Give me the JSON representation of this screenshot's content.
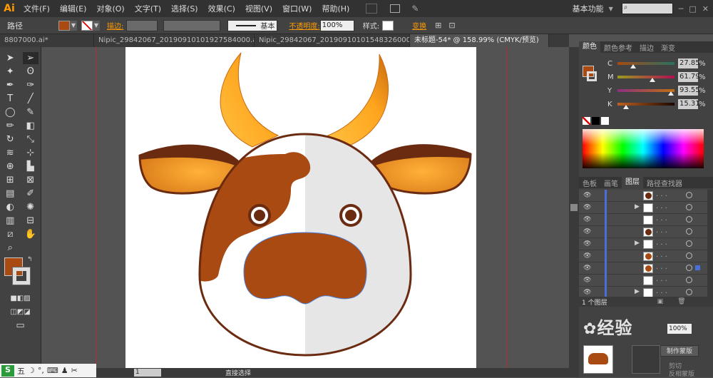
{
  "app": {
    "logo": "Ai",
    "workspace": "基本功能"
  },
  "menu": [
    "文件(F)",
    "编辑(E)",
    "对象(O)",
    "文字(T)",
    "选择(S)",
    "效果(C)",
    "视图(V)",
    "窗口(W)",
    "帮助(H)"
  ],
  "control": {
    "object_type": "路径",
    "stroke_label": "描边:",
    "stroke_profile": "基本",
    "opacity_label": "不透明度:",
    "opacity_value": "100%",
    "style_label": "样式:",
    "transform_label": "变换"
  },
  "tabs": [
    "8807000.ai*",
    "Nipic_29842067_20190910101927584000.ai*",
    "Nipic_29842067_20190910101548326000.ai*",
    "未标题-54* @ 158.99% (CMYK/预览)"
  ],
  "colors": {
    "fill": "#a84a12",
    "dark_brown": "#6b2b10",
    "horn_light": "#ffb12a",
    "face_gray": "#e6e6e6",
    "accent_orange": "#ff9a00"
  },
  "color_panel": {
    "tabs": [
      "颜色",
      "颜色参考",
      "描边",
      "渐变"
    ],
    "channels": [
      {
        "label": "C",
        "value": "27.85",
        "unit": "%",
        "level": 0.2785
      },
      {
        "label": "M",
        "value": "61.79",
        "unit": "%",
        "level": 0.6179
      },
      {
        "label": "Y",
        "value": "93.55",
        "unit": "%",
        "level": 0.9355
      },
      {
        "label": "K",
        "value": "15.31",
        "unit": "%",
        "level": 0.1531
      }
    ]
  },
  "layers_panel": {
    "tabs": [
      "色板",
      "画笔",
      "图层",
      "路径查找器"
    ],
    "footer": "1 个图层",
    "rows": [
      {
        "arrow": "",
        "thumb": "#6b2b10",
        "selected": false
      },
      {
        "arrow": "▶",
        "thumb": "#ffffff",
        "selected": false
      },
      {
        "arrow": "",
        "thumb": "#ffffff",
        "selected": false
      },
      {
        "arrow": "",
        "thumb": "#6b2b10",
        "selected": false
      },
      {
        "arrow": "▶",
        "thumb": "#ffffff",
        "selected": false
      },
      {
        "arrow": "",
        "thumb": "#a84a12",
        "selected": false
      },
      {
        "arrow": "",
        "thumb": "#a84a12",
        "selected": true
      },
      {
        "arrow": "",
        "thumb": "#ffffff",
        "selected": false
      },
      {
        "arrow": "▶",
        "thumb": "#ffffff",
        "selected": false
      }
    ]
  },
  "bottom_panel": {
    "opacity_value": "100%",
    "make_mask": "制作蒙版",
    "clip": "剪切",
    "invert_mask": "反相蒙版"
  },
  "status": {
    "zoom": "1",
    "tool": "直接选择"
  },
  "taskbar": {
    "ime": "五"
  },
  "watermark": "经验"
}
